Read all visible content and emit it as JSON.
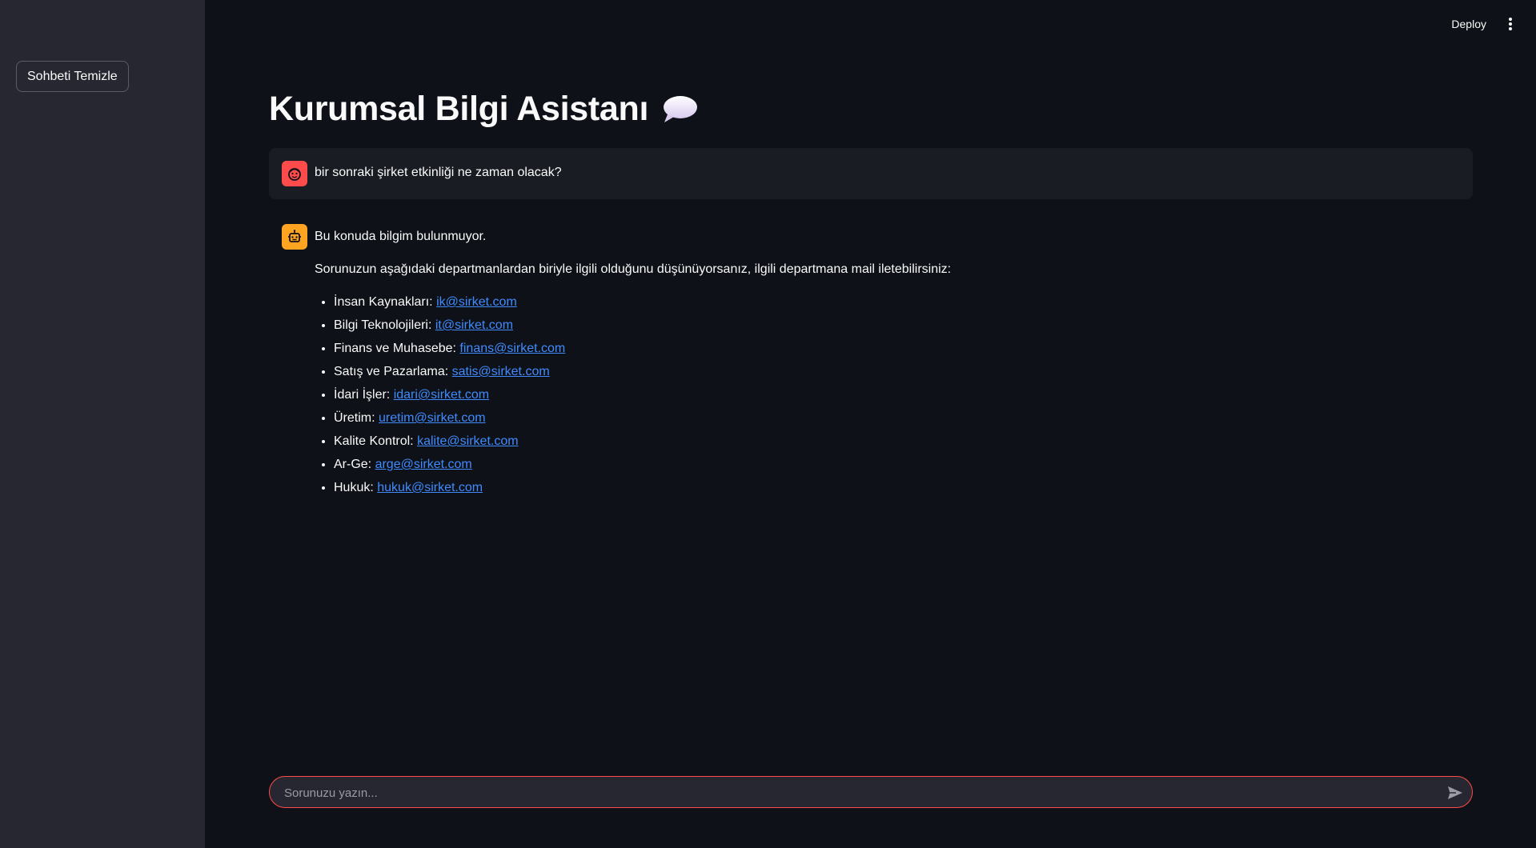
{
  "sidebar": {
    "clear_button": "Sohbeti Temizle"
  },
  "header": {
    "deploy_label": "Deploy"
  },
  "page": {
    "title": "Kurumsal Bilgi Asistanı",
    "title_icon": "speech-balloon-icon"
  },
  "messages": {
    "user": {
      "text": "bir sonraki şirket etkinliği ne zaman olacak?",
      "avatar": "user-face-icon"
    },
    "assistant": {
      "avatar": "robot-icon",
      "line1": "Bu konuda bilgim bulunmuyor.",
      "line2": "Sorunuzun aşağıdaki departmanlardan biriyle ilgili olduğunu düşünüyorsanız, ilgili departmana mail iletebilirsiniz:",
      "departments": [
        {
          "label": "İnsan Kaynakları: ",
          "email": "ik@sirket.com"
        },
        {
          "label": "Bilgi Teknolojileri: ",
          "email": "it@sirket.com"
        },
        {
          "label": "Finans ve Muhasebe: ",
          "email": "finans@sirket.com"
        },
        {
          "label": "Satış ve Pazarlama: ",
          "email": "satis@sirket.com"
        },
        {
          "label": "İdari İşler: ",
          "email": "idari@sirket.com"
        },
        {
          "label": "Üretim: ",
          "email": "uretim@sirket.com"
        },
        {
          "label": "Kalite Kontrol: ",
          "email": "kalite@sirket.com"
        },
        {
          "label": "Ar-Ge: ",
          "email": "arge@sirket.com"
        },
        {
          "label": "Hukuk: ",
          "email": "hukuk@sirket.com"
        }
      ]
    }
  },
  "chat_input": {
    "placeholder": "Sorunuzu yazın...",
    "value": ""
  },
  "colors": {
    "background": "#0e1117",
    "sidebar": "#262730",
    "accent": "#ff4b4b",
    "bot_avatar": "#ffa421",
    "link": "#3f8bff"
  }
}
